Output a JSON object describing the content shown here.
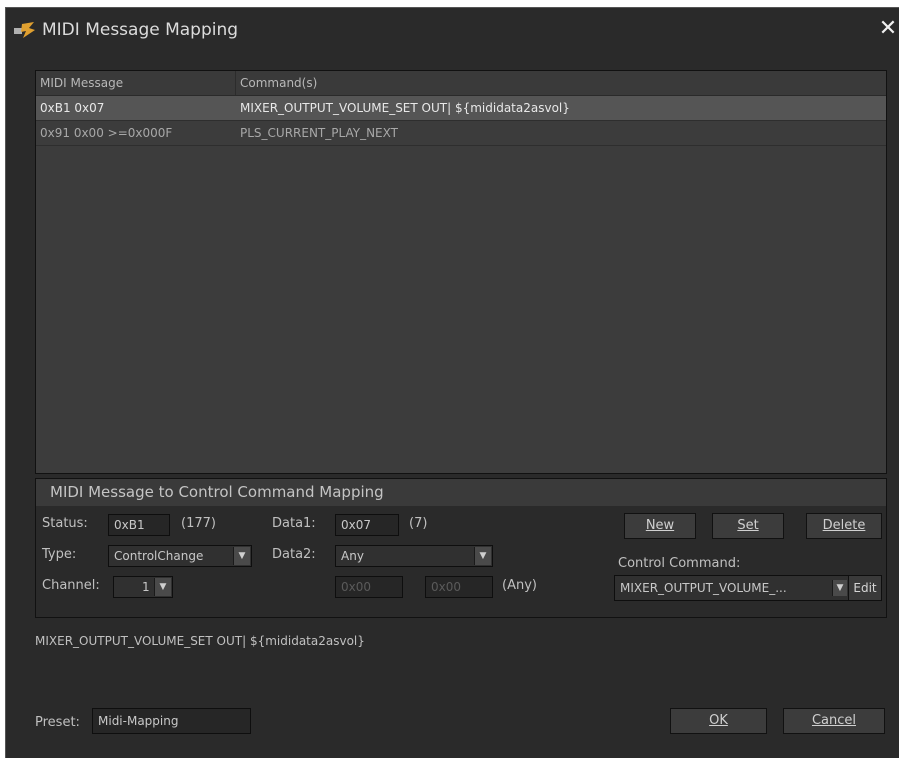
{
  "window": {
    "title": "MIDI Message Mapping",
    "close_symbol": "✕"
  },
  "list": {
    "columns": [
      "MIDI Message",
      "Command(s)"
    ],
    "rows": [
      {
        "message": "0xB1 0x07",
        "command": "MIXER_OUTPUT_VOLUME_SET OUT| ${mididata2asvol}",
        "selected": true
      },
      {
        "message": "0x91 0x00 >=0x000F",
        "command": "PLS_CURRENT_PLAY_NEXT",
        "selected": false
      }
    ]
  },
  "mapping": {
    "title": "MIDI Message to Control Command Mapping",
    "status_label": "Status:",
    "status_value": "0xB1",
    "status_decimal": "(177)",
    "data1_label": "Data1:",
    "data1_value": "0x07",
    "data1_decimal": "(7)",
    "type_label": "Type:",
    "type_value": "ControlChange",
    "data2_label": "Data2:",
    "data2_value": "Any",
    "channel_label": "Channel:",
    "channel_value": "1",
    "range_from": "0x00",
    "range_to": "0x00",
    "range_note": "(Any)",
    "buttons": {
      "new": "New",
      "set": "Set",
      "delete": "Delete"
    },
    "control_command_label": "Control Command:",
    "control_command_value": "MIXER_OUTPUT_VOLUME_...",
    "edit_label": "Edit"
  },
  "command_line": "MIXER_OUTPUT_VOLUME_SET OUT| ${mididata2asvol}",
  "footer": {
    "preset_label": "Preset:",
    "preset_value": "Midi-Mapping",
    "ok_label": "OK",
    "cancel_label": "Cancel"
  }
}
